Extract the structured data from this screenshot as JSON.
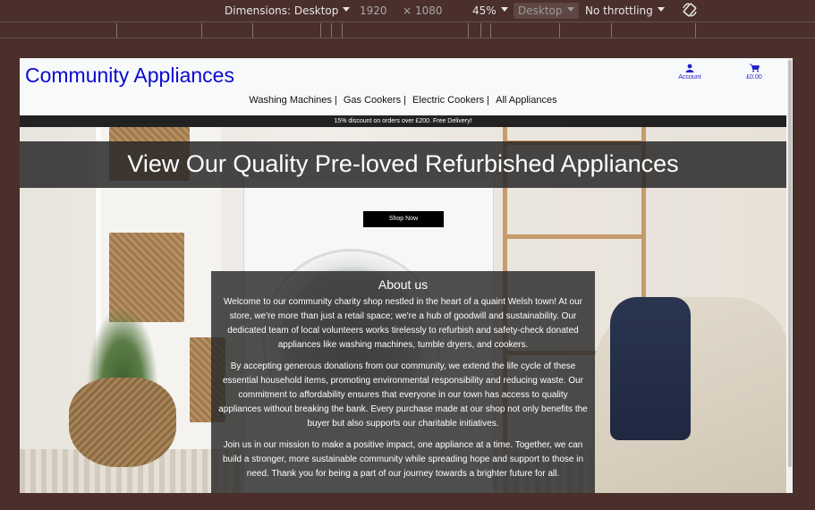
{
  "devtools": {
    "dimensions_label": "Dimensions: Desktop",
    "width": "1920",
    "times": "×",
    "height": "1080",
    "zoom": "45%",
    "device_type": "Desktop",
    "throttling": "No throttling"
  },
  "site": {
    "logo": "Community Appliances",
    "account_label": "Account",
    "bag_total": "£0.00",
    "nav": [
      "Washing Machines |",
      "Gas Cookers |",
      "Electric Cookers |",
      "All Appliances"
    ],
    "promo": "15% discount on orders over £200. Free Delivery!",
    "hero_title": "View Our Quality Pre-loved Refurbished Appliances",
    "shop_now": "Shop Now",
    "about": {
      "heading": "About us",
      "paragraphs": [
        "Welcome to our community charity shop nestled in the heart of a quaint Welsh town! At our store, we're more than just a retail space; we're a hub of goodwill and sustainability. Our dedicated team of local volunteers works tirelessly to refurbish and safety-check donated appliances like washing machines, tumble dryers, and cookers.",
        "By accepting generous donations from our community, we extend the life cycle of these essential household items, promoting environmental responsibility and reducing waste. Our commitment to affordability ensures that everyone in our town has access to quality appliances without breaking the bank. Every purchase made at our shop not only benefits the buyer but also supports our charitable initiatives.",
        "Join us in our mission to make a positive impact, one appliance at a time. Together, we can build a stronger, more sustainable community while spreading hope and support to those in need. Thank you for being a part of our journey towards a brighter future for all."
      ]
    }
  }
}
